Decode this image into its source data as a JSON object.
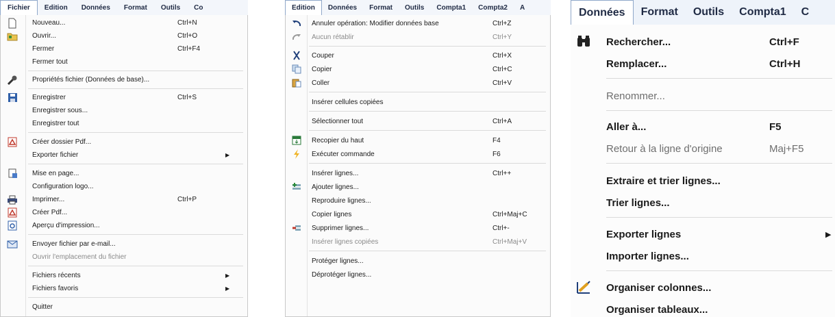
{
  "menu_fichier": {
    "menubar": [
      "Fichier",
      "Edition",
      "Données",
      "Format",
      "Outils",
      "Co"
    ],
    "items": [
      {
        "label": "Nouveau...",
        "shortcut": "Ctrl+N",
        "icon": "new-document-icon"
      },
      {
        "label": "Ouvrir...",
        "shortcut": "Ctrl+O",
        "icon": "open-folder-icon"
      },
      {
        "label": "Fermer",
        "shortcut": "Ctrl+F4"
      },
      {
        "label": "Fermer tout"
      },
      {
        "label": "Propriétés fichier (Données de base)...",
        "icon": "wrench-icon"
      },
      {
        "label": "Enregistrer",
        "shortcut": "Ctrl+S",
        "icon": "save-icon"
      },
      {
        "label": "Enregistrer sous..."
      },
      {
        "label": "Enregistrer tout"
      },
      {
        "label": "Créer dossier Pdf...",
        "icon": "pdf-icon"
      },
      {
        "label": "Exporter fichier",
        "submenu": true
      },
      {
        "label": "Mise en page...",
        "icon": "page-setup-icon"
      },
      {
        "label": "Configuration logo..."
      },
      {
        "label": "Imprimer...",
        "shortcut": "Ctrl+P",
        "icon": "printer-icon"
      },
      {
        "label": "Créer Pdf...",
        "icon": "pdf-icon"
      },
      {
        "label": "Aperçu d'impression...",
        "icon": "print-preview-icon"
      },
      {
        "label": "Envoyer fichier par e-mail...",
        "icon": "email-icon"
      },
      {
        "label": "Ouvrir l'emplacement du fichier",
        "disabled": true
      },
      {
        "label": "Fichiers récents",
        "submenu": true
      },
      {
        "label": "Fichiers favoris",
        "submenu": true
      },
      {
        "label": "Quitter"
      }
    ]
  },
  "menu_edition": {
    "menubar": [
      "Edition",
      "Données",
      "Format",
      "Outils",
      "Compta1",
      "Compta2",
      "A"
    ],
    "items": [
      {
        "label": "Annuler opération: Modifier données base",
        "shortcut": "Ctrl+Z",
        "icon": "undo-icon"
      },
      {
        "label": "Aucun rétablir",
        "shortcut": "Ctrl+Y",
        "icon": "redo-icon",
        "disabled": true
      },
      {
        "label": "Couper",
        "shortcut": "Ctrl+X",
        "icon": "scissors-icon"
      },
      {
        "label": "Copier",
        "shortcut": "Ctrl+C",
        "icon": "copy-icon"
      },
      {
        "label": "Coller",
        "shortcut": "Ctrl+V",
        "icon": "paste-icon"
      },
      {
        "label": "Insérer cellules copiées"
      },
      {
        "label": "Sélectionner tout",
        "shortcut": "Ctrl+A"
      },
      {
        "label": "Recopier du haut",
        "shortcut": "F4",
        "icon": "fill-down-icon"
      },
      {
        "label": "Exécuter commande",
        "shortcut": "F6",
        "icon": "lightning-icon"
      },
      {
        "label": "Insérer lignes...",
        "shortcut": "Ctrl++"
      },
      {
        "label": "Ajouter lignes...",
        "icon": "add-rows-icon"
      },
      {
        "label": "Reproduire lignes..."
      },
      {
        "label": "Copier lignes",
        "shortcut": "Ctrl+Maj+C"
      },
      {
        "label": "Supprimer lignes...",
        "shortcut": "Ctrl+-",
        "icon": "delete-rows-icon"
      },
      {
        "label": "Insérer lignes copiées",
        "shortcut": "Ctrl+Maj+V",
        "disabled": true
      },
      {
        "label": "Protéger lignes..."
      },
      {
        "label": "Déprotéger lignes..."
      }
    ]
  },
  "menu_donnees": {
    "menubar": [
      "Données",
      "Format",
      "Outils",
      "Compta1",
      "C"
    ],
    "items": [
      {
        "label": "Rechercher...",
        "shortcut": "Ctrl+F",
        "icon": "binoculars-icon"
      },
      {
        "label": "Remplacer...",
        "shortcut": "Ctrl+H"
      },
      {
        "label": "Renommer...",
        "disabled": true
      },
      {
        "label": "Aller à...",
        "shortcut": "F5"
      },
      {
        "label": "Retour à la ligne d'origine",
        "shortcut": "Maj+F5",
        "disabled": true
      },
      {
        "label": "Extraire et trier lignes..."
      },
      {
        "label": "Trier lignes..."
      },
      {
        "label": "Exporter lignes",
        "submenu": true
      },
      {
        "label": "Importer lignes..."
      },
      {
        "label": "Organiser colonnes...",
        "icon": "organize-columns-icon"
      },
      {
        "label": "Organiser tableaux..."
      }
    ]
  },
  "colors": {
    "menubar_text": "#1f2a44",
    "disabled_text": "#8a8a8a",
    "active_border": "#8fa7c9"
  }
}
